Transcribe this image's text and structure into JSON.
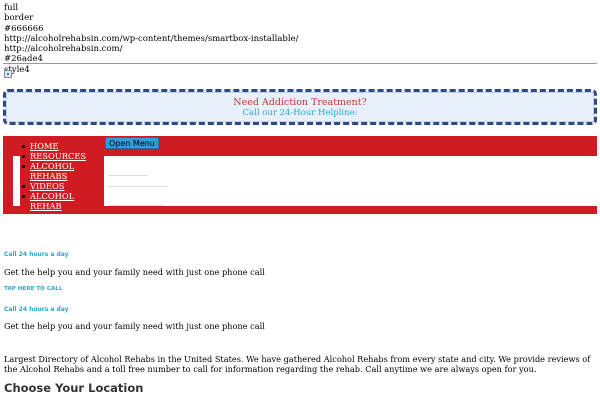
{
  "debug_lines": [
    "full",
    "border",
    "#666666",
    "http://alcoholrehabsin.com/wp-content/themes/smartbox-installable/",
    "http://alcoholrehabsin.com/",
    "#26ade4",
    "style4"
  ],
  "icons": {
    "small_image": "broken-image-icon"
  },
  "cta": {
    "title": "Need Addiction Treatment?",
    "subtitle": "Call our 24-Hour Helpline:"
  },
  "nav": {
    "open_menu_label": "Open Menu",
    "items": [
      {
        "label": "HOME"
      },
      {
        "label": "RESOURCES"
      },
      {
        "label": "ALCOHOL REHABS"
      },
      {
        "label": "VIDEOS"
      },
      {
        "label": "ALCOHOL REHAB"
      }
    ]
  },
  "call_blocks": [
    {
      "label": "Call 24 hours a day",
      "text": "Get the help you and your family need with just one phone call",
      "link": "TAP HERE TO CALL"
    },
    {
      "label": "Call 24 hours a day",
      "text": "Get the help you and your family need with just one phone call"
    }
  ],
  "description": "Largest Directory of Alcohol Rehabs in the United States. We have gathered Alcohol Rehabs from every state and city. We provide reviews of the Alcohol Rehabs and a toll free number to call for information regarding the rehab. Call anytime we are always open for you.",
  "section_heading": "Choose Your Location",
  "colors": {
    "nav_red": "#d01b22",
    "accent_blue": "#2aa6cf",
    "cta_border": "#2f4a80",
    "cta_title": "#c0392b"
  }
}
